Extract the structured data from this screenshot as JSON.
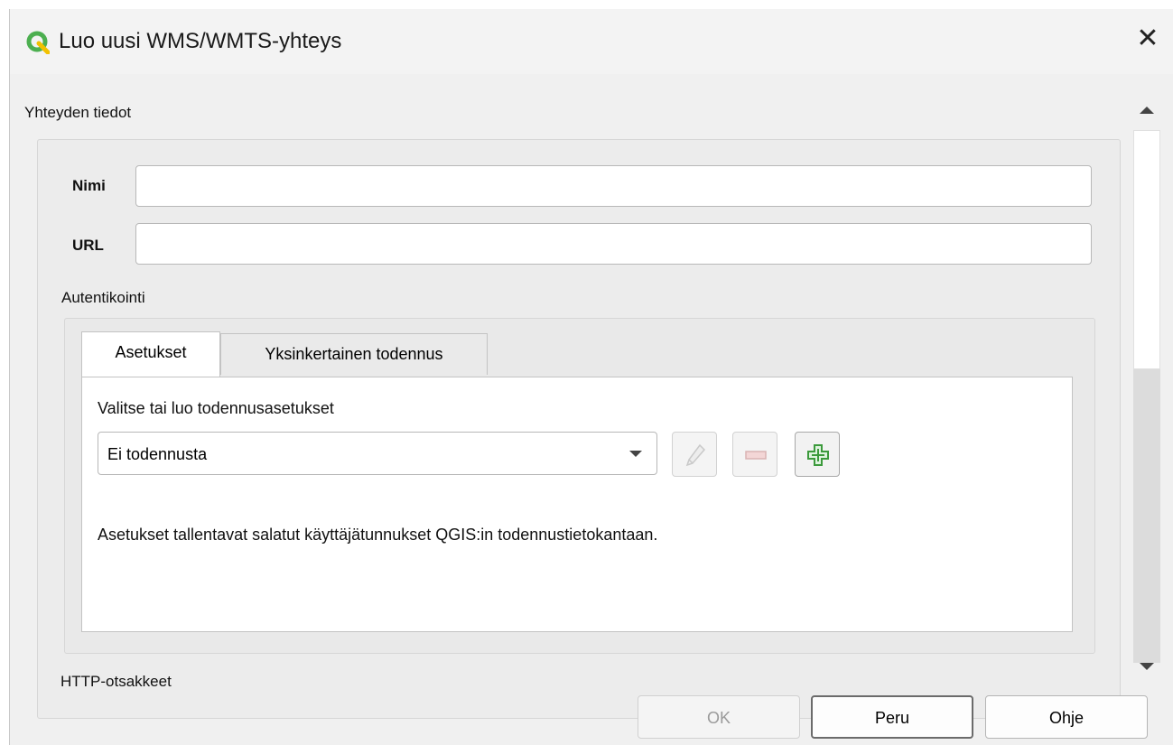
{
  "window": {
    "title": "Luo uusi WMS/WMTS-yhteys",
    "logo_icon": "qgis-logo-icon",
    "close_symbol": "✕"
  },
  "connection_details": {
    "group_title": "Yhteyden tiedot",
    "name_label": "Nimi",
    "name_value": "",
    "url_label": "URL",
    "url_value": ""
  },
  "authentication": {
    "group_title": "Autentikointi",
    "tabs": [
      {
        "label": "Asetukset",
        "active": true
      },
      {
        "label": "Yksinkertainen todennus",
        "active": false
      }
    ],
    "config_prompt": "Valitse tai luo todennusasetukset",
    "config_selected": "Ei todennusta",
    "actions": [
      {
        "name": "edit",
        "icon": "pencil-icon",
        "enabled": false
      },
      {
        "name": "remove",
        "icon": "minus-icon",
        "enabled": false
      },
      {
        "name": "add",
        "icon": "plus-icon",
        "enabled": true
      }
    ],
    "info_text": "Asetukset tallentavat salatut käyttäjätunnukset QGIS:in todennustietokantaan."
  },
  "http_headers": {
    "group_title": "HTTP-otsakkeet"
  },
  "buttons": {
    "ok": "OK",
    "cancel": "Peru",
    "help": "Ohje"
  },
  "colors": {
    "logo_green": "#4caf50",
    "logo_yellow": "#f2c100",
    "add_green": "#3c9a3c"
  }
}
